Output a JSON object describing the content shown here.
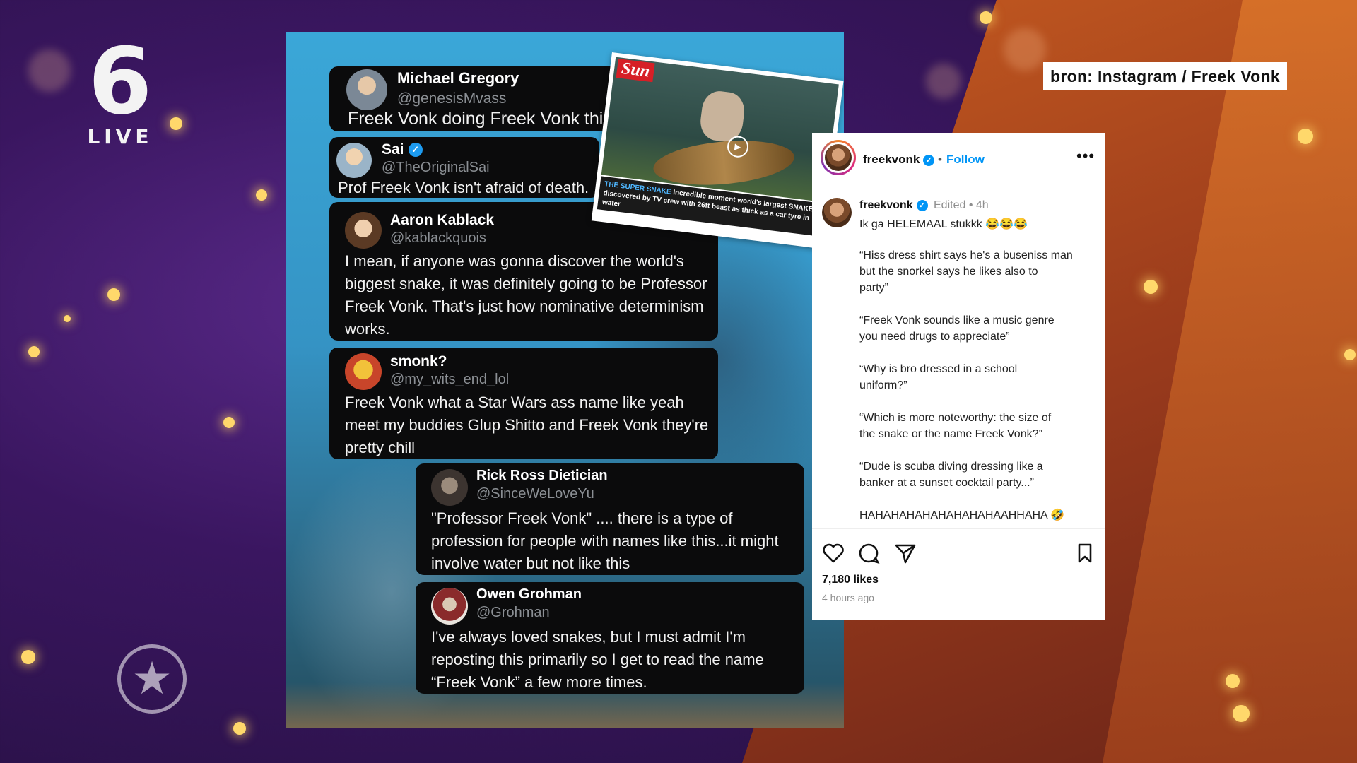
{
  "channel": {
    "logo_number": "6",
    "logo_sub": "LIVE",
    "badge_icon": "star-icon"
  },
  "source_label": "bron: Instagram / Freek Vonk",
  "collage": {
    "tweets": [
      {
        "name": "Michael Gregory",
        "handle": "@genesisMvass",
        "verified": false,
        "text": "Freek Vonk doing Freek Vonk things"
      },
      {
        "name": "Sai",
        "handle": "@TheOriginalSai",
        "verified": true,
        "text": "Prof Freek Vonk isn't afraid of death."
      },
      {
        "name": "Aaron Kablack",
        "handle": "@kablackquois",
        "verified": false,
        "text": "I mean, if anyone was gonna discover the world's biggest snake, it was definitely going to be Professor Freek Vonk. That's just how nominative determinism works."
      },
      {
        "name": "smonk?",
        "handle": "@my_wits_end_lol",
        "verified": false,
        "text": "Freek Vonk what a Star Wars ass name like yeah meet my buddies Glup Shitto and Freek Vonk they're pretty chill"
      },
      {
        "name": "Rick Ross Dietician",
        "handle": "@SinceWeLoveYu",
        "verified": false,
        "text": "\"Professor Freek Vonk\" .... there is a type of profession for people with names like this...it might involve water but not like this"
      },
      {
        "name": "Owen Grohman",
        "handle": "@Grohman",
        "verified": false,
        "text": "I've always loved snakes, but I must admit I'm reposting this primarily so I get to read the name “Freek Vonk” a few more times."
      }
    ],
    "news_clip": {
      "logo": "Sun",
      "caption_highlight": "THE SUPER SNAKE",
      "caption": "Incredible moment world's largest SNAKE discovered by TV crew with 26ft beast as thick as a car tyre in water"
    }
  },
  "instagram": {
    "username": "freekvonk",
    "follow_label": "Follow",
    "more_icon": "•••",
    "caption_user": "freekvonk",
    "edited": "Edited • 4h",
    "lines": [
      "Ik ga HELEMAAL stukkk 😂😂😂",
      "“Hiss dress shirt says he's a buseniss man",
      "but the snorkel says he likes also to",
      "party”",
      "“Freek Vonk sounds like a music genre",
      "you need drugs to appreciate”",
      "“Why is bro dressed in a school",
      "uniform?”",
      "“Which is more noteworthy: the size of",
      "the snake or the name Freek Vonk?”",
      "“Dude is scuba diving dressing like a",
      "banker at a sunset cocktail party...”",
      "HAHAHAHAHAHAHAHAHAAHHAHA 🤣"
    ],
    "likes": "7,180 likes",
    "time_ago": "4 hours ago"
  }
}
